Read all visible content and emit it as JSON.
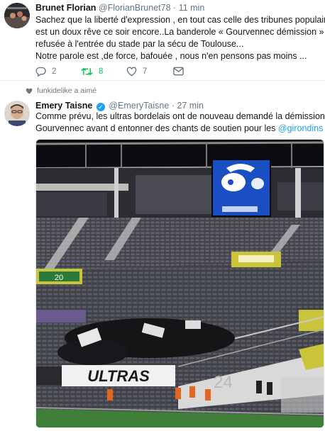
{
  "tweet1": {
    "display_name": "Brunet Florian",
    "handle": "@FlorianBrunet78",
    "separator": "·",
    "time": "11 min",
    "text_lines": [
      "Sachez que la liberté d'expression , en tout cas celle des tribunes populaires",
      "est un doux rêve ce soir encore..La banderole « Gourvennec démission »",
      "refusée à l'entrée du stade par la sécu de Toulouse...",
      "Notre parole est ,de force, bafouée , nous n'en pensons pas moins ..."
    ],
    "actions": {
      "reply_count": "2",
      "retweet_count": "8",
      "like_count": "7"
    }
  },
  "tweet2": {
    "liked_by": "funkidelike a aimé",
    "display_name": "Emery Taisne",
    "handle": "@EmeryTaisne",
    "separator": "·",
    "time": "27 min",
    "text_line1": "Comme prévu, les ultras bordelais ont de nouveau demandé la démission de",
    "text_line2_prefix": "Gourvennec avant d entonner des chants de soutien pour les ",
    "mention": "@girondins",
    "photo": {
      "banner_text": "ULTRAS",
      "section_number": "24",
      "stand_sign": "20"
    }
  },
  "colors": {
    "accent": "#1da1f2",
    "retweet_green": "#17bf63",
    "secondary_text": "#657786",
    "stadium_seat": "#4a4b52",
    "screen_blue": "#1a4fc4"
  },
  "icons": [
    "reply-icon",
    "retweet-icon",
    "like-icon",
    "dm-icon",
    "heart-small-icon",
    "verified-icon"
  ]
}
